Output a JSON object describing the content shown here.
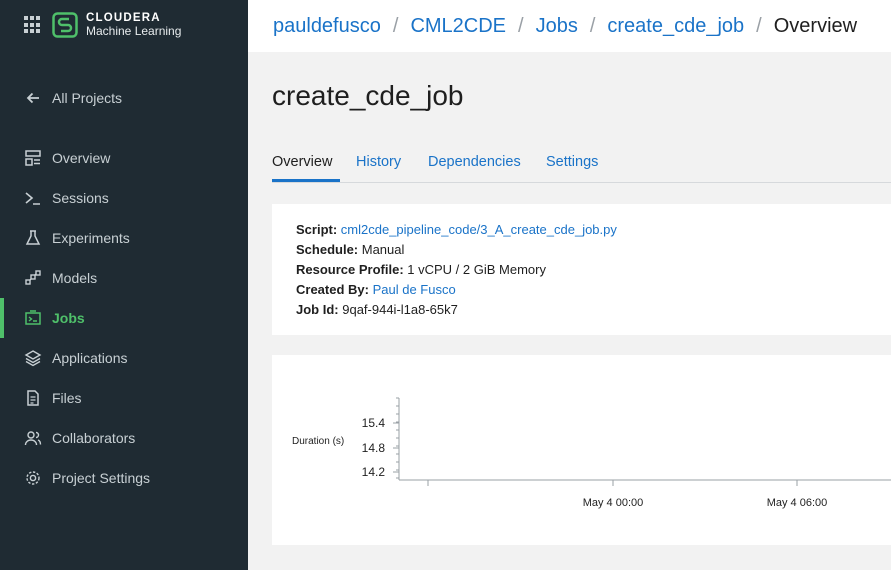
{
  "brand": {
    "line1": "CLOUDERA",
    "line2": "Machine Learning"
  },
  "sidebar": {
    "back": {
      "label": "All Projects",
      "icon": "arrow-left-icon"
    },
    "items": [
      {
        "label": "Overview",
        "icon": "overview-icon"
      },
      {
        "label": "Sessions",
        "icon": "terminal-icon"
      },
      {
        "label": "Experiments",
        "icon": "flask-icon"
      },
      {
        "label": "Models",
        "icon": "models-icon"
      },
      {
        "label": "Jobs",
        "icon": "jobs-icon",
        "active": true
      },
      {
        "label": "Applications",
        "icon": "layers-icon"
      },
      {
        "label": "Files",
        "icon": "file-icon"
      },
      {
        "label": "Collaborators",
        "icon": "people-icon"
      },
      {
        "label": "Project Settings",
        "icon": "gear-icon"
      }
    ],
    "active_color": "#4fc06a"
  },
  "breadcrumb": {
    "items": [
      "pauldefusco",
      "CML2CDE",
      "Jobs",
      "create_cde_job"
    ],
    "current": "Overview"
  },
  "page": {
    "title": "create_cde_job"
  },
  "tabs": [
    "Overview",
    "History",
    "Dependencies",
    "Settings"
  ],
  "job": {
    "script_label": "Script:",
    "script_value": "cml2cde_pipeline_code/3_A_create_cde_job.py",
    "schedule_label": "Schedule:",
    "schedule_value": "Manual",
    "resource_label": "Resource Profile:",
    "resource_value": "1 vCPU / 2 GiB Memory",
    "created_label": "Created By:",
    "created_value": "Paul de Fusco",
    "jobid_label": "Job Id:",
    "jobid_value": "9qaf-944i-l1a8-65k7"
  },
  "chart_data": {
    "type": "line",
    "title": "",
    "ylabel": "Duration (s)",
    "xlabel": "",
    "y_ticks": [
      "15.4",
      "14.8",
      "14.2"
    ],
    "x_ticks": [
      "May 4 00:00",
      "May 4 06:00"
    ],
    "series": []
  },
  "colors": {
    "sidebar_bg": "#1f2b33",
    "link": "#1a73c8",
    "accent": "#4fc06a"
  }
}
